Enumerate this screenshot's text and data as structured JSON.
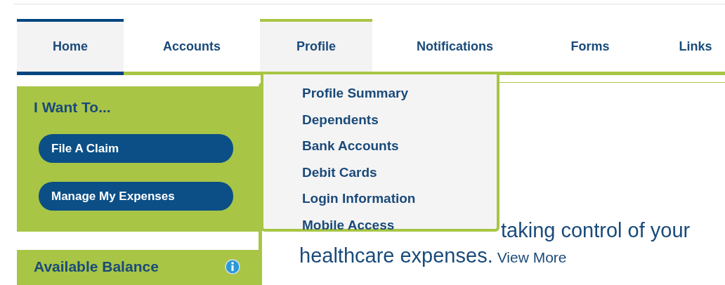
{
  "tabs": [
    {
      "label": "Home",
      "selected": true,
      "open": false
    },
    {
      "label": "Accounts",
      "selected": false,
      "open": false
    },
    {
      "label": "Profile",
      "selected": false,
      "open": true
    },
    {
      "label": "Notifications",
      "selected": false,
      "open": false
    },
    {
      "label": "Forms",
      "selected": false,
      "open": false
    },
    {
      "label": "Links",
      "selected": false,
      "open": false
    }
  ],
  "dropdown": {
    "items": [
      "Profile Summary",
      "Dependents",
      "Bank Accounts",
      "Debit Cards",
      "Login Information",
      "Mobile Access"
    ]
  },
  "sidebar": {
    "actions": {
      "title": "I Want To...",
      "buttons": [
        "File A Claim",
        "Manage My Expenses"
      ]
    },
    "balance": {
      "title": "Available Balance"
    }
  },
  "content": {
    "line_1": "taking control of your",
    "line_2": "healthcare expenses.",
    "link": "View More"
  }
}
